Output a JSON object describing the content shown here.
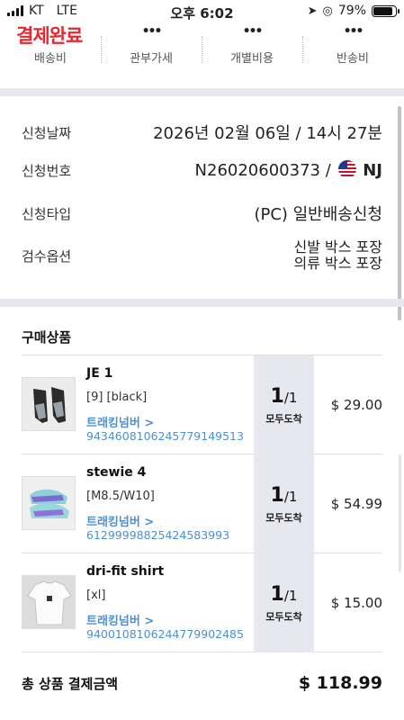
{
  "status_bar": {
    "carrier": "KT",
    "network": "LTE",
    "time": "오후 6:02",
    "battery": "79%"
  },
  "brand_fragment": "결제완료",
  "tabs": [
    {
      "label": "배송비"
    },
    {
      "label": "관부가세"
    },
    {
      "label": "개별비용"
    },
    {
      "label": "반송비"
    }
  ],
  "info": {
    "date_label": "신청날짜",
    "date_value": "2026년 02월 06일 / 14시 27분",
    "number_label": "신청번호",
    "number_value": "N26020600373 /",
    "region": "NJ",
    "type_label": "신청타입",
    "type_value": "(PC) 일반배송신청",
    "inspect_label": "검수옵션",
    "inspect_options": [
      "신발 박스 포장",
      "의류 박스 포장"
    ]
  },
  "products_title": "구매상품",
  "products": [
    {
      "name": "JE 1",
      "option": "[9] [black]",
      "track_label": "트래킹넘버 >",
      "track_number": "9434608106245779149513",
      "qty": "1",
      "qty_total": "/1",
      "status": "모두도착",
      "price": "$ 29.00"
    },
    {
      "name": "stewie 4",
      "option": "[M8.5/W10]",
      "track_label": "트래킹넘버 >",
      "track_number": "61299998825424583993",
      "qty": "1",
      "qty_total": "/1",
      "status": "모두도착",
      "price": "$ 54.99"
    },
    {
      "name": "dri-fit shirt",
      "option": "[xl]",
      "track_label": "트래킹넘버 >",
      "track_number": "9400108106244779902485",
      "qty": "1",
      "qty_total": "/1",
      "status": "모두도착",
      "price": "$ 15.00"
    }
  ],
  "total": {
    "label": "총 상품 결제금액",
    "value": "$ 118.99"
  },
  "colors": {
    "brand_red": "#e8262f",
    "link_blue": "#4a90d9",
    "panel_gray": "#e6e8ee"
  }
}
